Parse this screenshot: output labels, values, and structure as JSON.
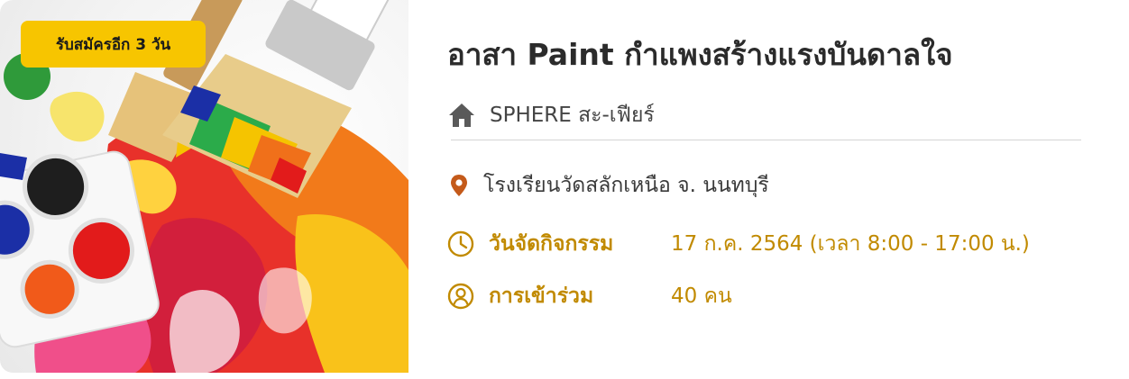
{
  "card": {
    "badge": "รับสมัครอีก 3 วัน",
    "title": "อาสา Paint กำแพงสร้างแรงบันดาลใจ",
    "organizer": {
      "icon": "home-icon",
      "name": "SPHERE สะ-เฟียร์"
    },
    "location": {
      "icon": "map-pin-icon",
      "text": "โรงเรียนวัดสลักเหนือ จ. นนทบุรี"
    },
    "date": {
      "icon": "clock-icon",
      "label": "วันจัดกิจกรรม",
      "value": "17 ก.ค. 2564 (เวลา 8:00 - 17:00 น.)"
    },
    "seats": {
      "icon": "user-circle-icon",
      "label": "การเข้าร่วม",
      "value": "40 คน"
    }
  },
  "colors": {
    "badge": "#f7c500",
    "accent": "#c18a00",
    "location_pin": "#c45a1a",
    "home_icon": "#5a5a5a",
    "title": "#2b2b2b"
  }
}
